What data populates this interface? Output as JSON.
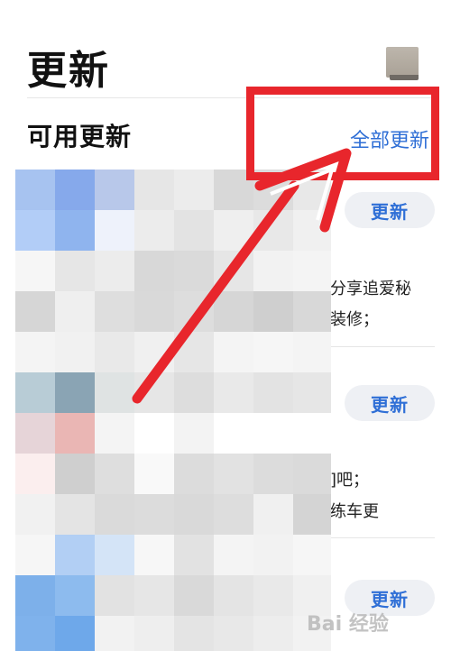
{
  "header": {
    "title": "更新"
  },
  "section": {
    "title": "可用更新",
    "update_all_label": "全部更新"
  },
  "items": [
    {
      "button_label": "更新",
      "desc_lines": [
        "分享追爱秘",
        "装修；"
      ]
    },
    {
      "button_label": "更新",
      "desc_lines": [
        "]吧；",
        "练车更"
      ]
    },
    {
      "button_label": "更新",
      "desc_lines": []
    }
  ],
  "watermark": {
    "text": "Bai 经验"
  },
  "colors": {
    "accent": "#2f6fd6",
    "annotation_red": "#e8262c",
    "button_bg": "#eef0f4"
  },
  "mosaic": [
    [
      "#a7c3f0",
      "#86a9eb",
      "#b8c8ea",
      "#e6e6e6",
      "#ececec",
      "#d8d8d8",
      "#dcdcdc",
      "#e8e8e8"
    ],
    [
      "#b2cdf7",
      "#8fb4ee",
      "#eef2fb",
      "#ececec",
      "#e3e3e3",
      "#efefef",
      "#e8e8e8",
      "#f0f0f0"
    ],
    [
      "#f6f6f6",
      "#e6e6e6",
      "#ececec",
      "#d8d8d8",
      "#dadada",
      "#e6e6e6",
      "#f2f2f2",
      "#f4f4f4"
    ],
    [
      "#d6d6d6",
      "#efefef",
      "#dedede",
      "#d9d9d9",
      "#dddddd",
      "#d6d6d6",
      "#cfcfcf",
      "#d8d8d8"
    ],
    [
      "#f4f4f4",
      "#f1f1f1",
      "#e9e9e9",
      "#f0f0f0",
      "#e6e6e6",
      "#f4f4f4",
      "#f6f6f6",
      "#f4f4f4"
    ],
    [
      "#b8ccd6",
      "#8aa4b4",
      "#dfe3e3",
      "#e6e6e6",
      "#dddddd",
      "#e9e9e9",
      "#e3e3e3",
      "#e6e6e6"
    ],
    [
      "#e6d4d8",
      "#eab6b4",
      "#f4f4f4",
      "#ffffff",
      "#f3f3f3",
      "#ffffff",
      "#ffffff",
      "#ffffff"
    ],
    [
      "#fbeeee",
      "#cfcfcf",
      "#dedede",
      "#f9f9f9",
      "#dcdcdc",
      "#e2e2e2",
      "#dcdcdc",
      "#dadada"
    ],
    [
      "#f1f1f1",
      "#e4e4e4",
      "#dadada",
      "#dcdcdc",
      "#d9d9d9",
      "#dddddd",
      "#f0f0f0",
      "#d4d4d4"
    ],
    [
      "#f6f6f6",
      "#b2cff4",
      "#d4e4f7",
      "#f7f7f7",
      "#e2e2e2",
      "#f4f4f4",
      "#f2f2f2",
      "#f6f6f6"
    ],
    [
      "#7db0ea",
      "#8dbbee",
      "#e2e2e2",
      "#e6e6e6",
      "#d9d9d9",
      "#e4e4e4",
      "#e9e9e9",
      "#f0f0f0"
    ],
    [
      "#7fb2ec",
      "#6ea8ea",
      "#f2f2f2",
      "#eeeeee",
      "#e4e4e4",
      "#e8e8e8",
      "#ededed",
      "#f2f2f2"
    ]
  ]
}
